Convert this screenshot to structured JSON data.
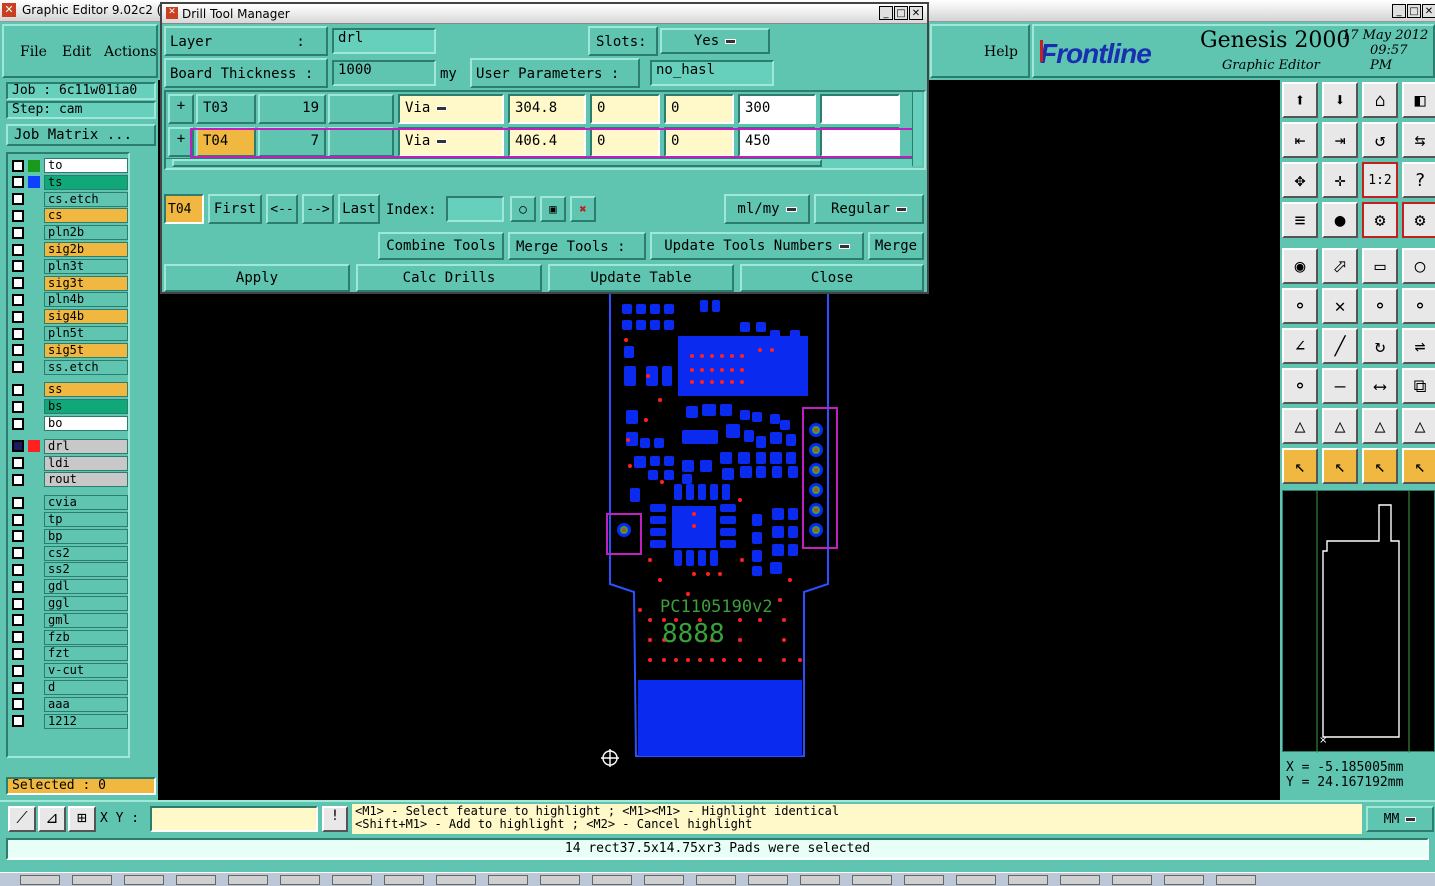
{
  "main_window": {
    "title": "Graphic Editor 9.02c2 (Д"
  },
  "menu": {
    "file": "File",
    "edit": "Edit",
    "actions": "Actions",
    "help": "Help"
  },
  "brand": {
    "logo": "Frontline",
    "product": "Genesis 2000",
    "subtitle": "Graphic Editor",
    "date": "17 May 2012",
    "time": "09:57 PM"
  },
  "job": {
    "job_label": "Job : 6c11w01ia0",
    "step_label": "Step: cam",
    "matrix_button": "Job Matrix ..."
  },
  "layers": [
    {
      "name": "to",
      "color": "#1a9a1a",
      "bg": "#ffffff"
    },
    {
      "name": "ts",
      "color": "#1040ff",
      "bg": "#10a878"
    },
    {
      "name": "cs.etch",
      "color": "",
      "bg": ""
    },
    {
      "name": "cs",
      "color": "",
      "bg": "#f0b840"
    },
    {
      "name": "pln2b",
      "color": "",
      "bg": ""
    },
    {
      "name": "sig2b",
      "color": "",
      "bg": "#f0b840"
    },
    {
      "name": "pln3t",
      "color": "",
      "bg": ""
    },
    {
      "name": "sig3t",
      "color": "",
      "bg": "#f0b840"
    },
    {
      "name": "pln4b",
      "color": "",
      "bg": ""
    },
    {
      "name": "sig4b",
      "color": "",
      "bg": "#f0b840"
    },
    {
      "name": "pln5t",
      "color": "",
      "bg": ""
    },
    {
      "name": "sig5t",
      "color": "",
      "bg": "#f0b840"
    },
    {
      "name": "ss.etch",
      "color": "",
      "bg": ""
    },
    {
      "name": "ss",
      "color": "",
      "bg": "#f0b840"
    },
    {
      "name": "bs",
      "color": "",
      "bg": "#10a878"
    },
    {
      "name": "bo",
      "color": "",
      "bg": "#ffffff"
    },
    {
      "name": "drl",
      "color": "#ff2020",
      "bg": "#c8c8c8",
      "sel": true
    },
    {
      "name": "ldi",
      "color": "",
      "bg": "#c8c8c8"
    },
    {
      "name": "rout",
      "color": "",
      "bg": "#c8c8c8"
    },
    {
      "name": "cvia",
      "color": "",
      "bg": ""
    },
    {
      "name": "tp",
      "color": "",
      "bg": ""
    },
    {
      "name": "bp",
      "color": "",
      "bg": ""
    },
    {
      "name": "cs2",
      "color": "",
      "bg": ""
    },
    {
      "name": "ss2",
      "color": "",
      "bg": ""
    },
    {
      "name": "gdl",
      "color": "",
      "bg": ""
    },
    {
      "name": "ggl",
      "color": "",
      "bg": ""
    },
    {
      "name": "gml",
      "color": "",
      "bg": ""
    },
    {
      "name": "fzb",
      "color": "",
      "bg": ""
    },
    {
      "name": "fzt",
      "color": "",
      "bg": ""
    },
    {
      "name": "v-cut",
      "color": "",
      "bg": ""
    },
    {
      "name": "d",
      "color": "",
      "bg": ""
    },
    {
      "name": "aaa",
      "color": "",
      "bg": ""
    },
    {
      "name": "1212",
      "color": "",
      "bg": ""
    }
  ],
  "selected": "Selected : 0",
  "dialog": {
    "title": "Drill Tool Manager",
    "layer_label": "Layer          :",
    "layer_value": "drl",
    "slots_label": "Slots:",
    "slots_value": "Yes",
    "thickness_label": "Board Thickness :",
    "thickness_value": "1000",
    "thickness_unit": "my",
    "user_params_label": "User Parameters :",
    "user_params_value": "no_hasl",
    "rows": [
      {
        "tool": "T03",
        "count": "19",
        "type": "Via",
        "size": "304.8",
        "v1": "0",
        "v2": "0",
        "finish": "300",
        "extra": ""
      },
      {
        "tool": "T04",
        "count": "7",
        "type": "Via",
        "size": "406.4",
        "v1": "0",
        "v2": "0",
        "finish": "450",
        "extra": ""
      }
    ],
    "current_tool": "T04",
    "first": "First",
    "prev": "<--",
    "next": "-->",
    "last": "Last",
    "index_label": "Index:",
    "units": "ml/my",
    "mode": "Regular",
    "combine": "Combine Tools",
    "merge_label": "Merge Tools :",
    "update_numbers": "Update Tools Numbers",
    "merge": "Merge",
    "apply": "Apply",
    "calc": "Calc Drills",
    "update_table": "Update Table",
    "close": "Close"
  },
  "board": {
    "text1": "PC1105190v2",
    "text2": "8888"
  },
  "coords": {
    "x": "X = -5.185005mm",
    "y": "Y = 24.167192mm"
  },
  "bottom": {
    "xy_label": "X Y :",
    "hint1": "<M1> - Select feature to highlight ; <M1><M1> - Highlight identical",
    "hint2": "<Shift+M1> - Add to highlight ; <M2> - Cancel highlight",
    "units": "MM",
    "status": "14 rect37.5x14.75xr3 Pads were selected"
  },
  "colors": {
    "panel": "#5fc4b0",
    "canvas": "#000000",
    "copper": "#0a2af0",
    "drill": "#ff2020",
    "silk": "#3aa03a",
    "highlight": "#c020c0"
  }
}
